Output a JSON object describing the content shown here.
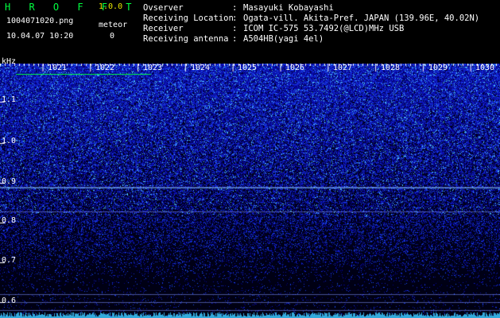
{
  "header": {
    "app_title": "H R O F F T",
    "app_version": "1.0.0",
    "filename": "1004071020.png",
    "datetime": "10.04.07 10:20",
    "meteor_label": "meteor",
    "meteor_count": "0",
    "info": [
      {
        "label": "Ovserver",
        "sep": ":",
        "value": "Masayuki Kobayashi"
      },
      {
        "label": "Receiving Location",
        "sep": ":",
        "value": "Ogata-vill. Akita-Pref. JAPAN (139.96E, 40.02N)"
      },
      {
        "label": "Receiver",
        "sep": ":",
        "value": "ICOM IC-575 53.7492(@LCD)MHz USB"
      },
      {
        "label": "Receiving antenna",
        "sep": ":",
        "value": "A504HB(yagi 4el)"
      }
    ]
  },
  "spectrogram": {
    "y_unit": "kHz",
    "y_ticks": [
      "1.1",
      "1.0",
      "0.9",
      "0.8",
      "0.7",
      "0.6"
    ],
    "time_labels": [
      "1021",
      "1022",
      "1023",
      "1024",
      "1025",
      "1026",
      "1027",
      "1028",
      "1029",
      "1030"
    ],
    "colors": {
      "noise": "#1a2dd6",
      "bright": "#5fd8ff",
      "marker": "#00ff40",
      "background": "#000000"
    }
  }
}
